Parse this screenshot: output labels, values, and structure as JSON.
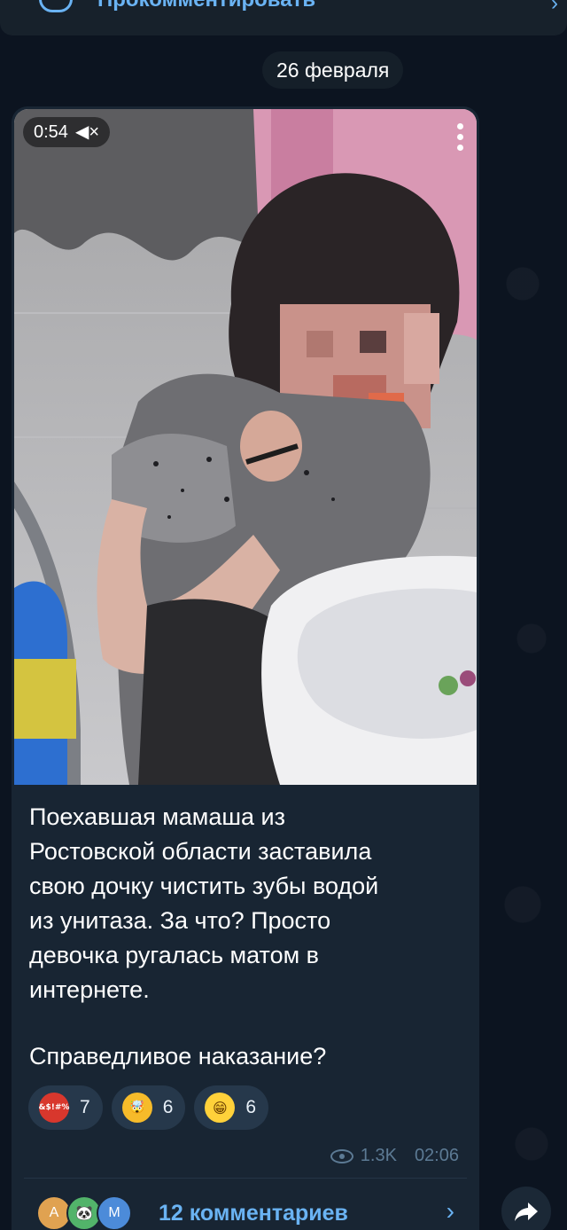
{
  "top_bar": {
    "label": "Прокомментировать",
    "chevron": "›"
  },
  "date_header": "26 февраля",
  "video": {
    "duration": "0:54",
    "mute_icon": "🔇",
    "more_icon": "more-vert-icon"
  },
  "post": {
    "text_paragraph_1": "Поехавшая мамаша из\nРостовской области заставила\nсвою дочку чистить зубы водой\nиз унитаза. За что? Просто\nдевочка ругалась матом в\nинтернете.",
    "text_paragraph_2": "Справедливое наказание?",
    "reactions": [
      {
        "emoji": "face-with-symbols-icon",
        "glyph": "&$!#%",
        "count": "7"
      },
      {
        "emoji": "exploding-head-icon",
        "glyph": "🤯",
        "count": "6"
      },
      {
        "emoji": "grinning-face-icon",
        "glyph": "😁",
        "count": "6"
      }
    ],
    "views": "1.3K",
    "time": "02:06"
  },
  "comments": {
    "avatars": [
      "А",
      "🐼",
      "M"
    ],
    "label": "12 комментариев",
    "chevron": "›"
  },
  "colors": {
    "accent": "#6ab3f3",
    "bubble": "#182533",
    "background": "#0c1420",
    "meta": "#5c7a94"
  }
}
